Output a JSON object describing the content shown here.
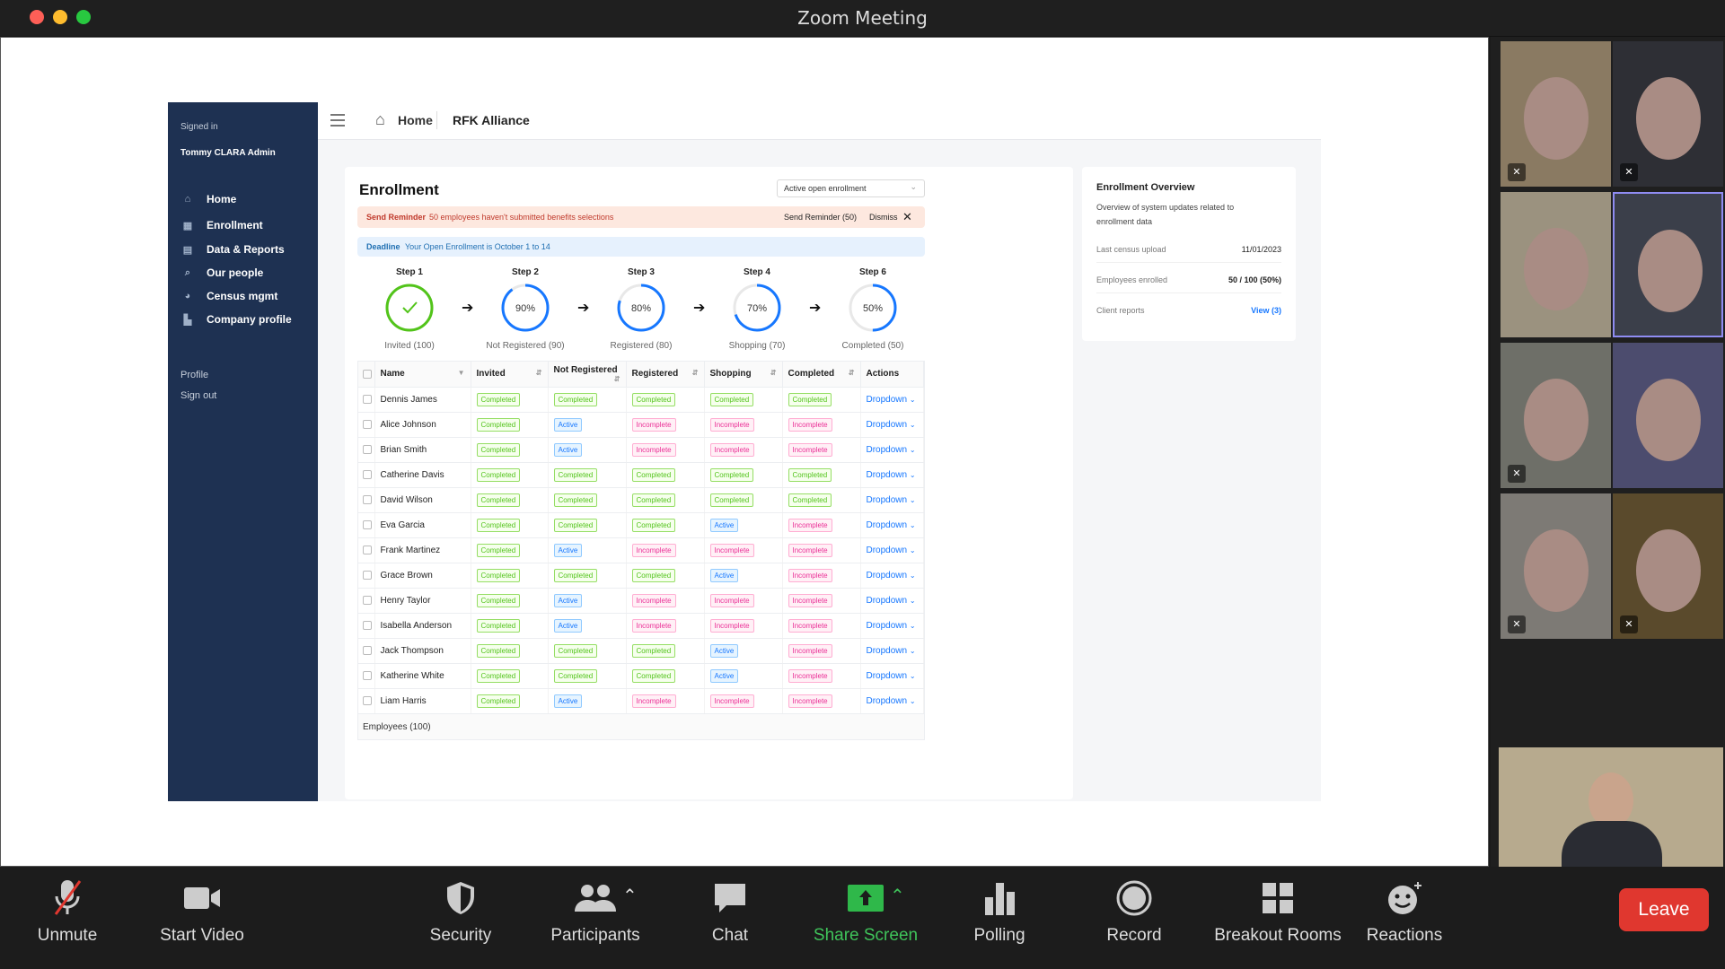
{
  "window": {
    "title": "Zoom Meeting"
  },
  "app": {
    "sidebar": {
      "signed_in": "Signed in",
      "user": "Tommy CLARA Admin",
      "nav": [
        "Home",
        "Enrollment",
        "Data & Reports",
        "Our people",
        "Census mgmt",
        "Company profile"
      ],
      "profile": "Profile",
      "sign_out": "Sign out"
    },
    "topnav": {
      "home": "Home",
      "org": "RFK Alliance"
    },
    "enrollment": {
      "title": "Enrollment",
      "select_value": "Active open enrollment",
      "reminder": {
        "label": "Send Reminder",
        "text": "50 employees haven't submitted benefits selections",
        "action": "Send Reminder (50)",
        "dismiss": "Dismiss"
      },
      "deadline": {
        "label": "Deadline",
        "text": "Your Open Enrollment is October 1 to 14"
      },
      "steps": [
        {
          "title": "Step 1",
          "value": "",
          "percent": 100,
          "check": true,
          "sub": "Invited (100)"
        },
        {
          "title": "Step 2",
          "value": "90%",
          "percent": 90,
          "sub": "Not Registered (90)"
        },
        {
          "title": "Step 3",
          "value": "80%",
          "percent": 80,
          "sub": "Registered (80)"
        },
        {
          "title": "Step 4",
          "value": "70%",
          "percent": 70,
          "sub": "Shopping (70)"
        },
        {
          "title": "Step 6",
          "value": "50%",
          "percent": 50,
          "sub": "Completed (50)"
        }
      ],
      "table": {
        "columns": [
          "Name",
          "Invited",
          "Not Registered",
          "Registered",
          "Shopping",
          "Completed",
          "Actions"
        ],
        "rows": [
          [
            "Dennis James",
            "Completed",
            "Completed",
            "Completed",
            "Completed",
            "Completed"
          ],
          [
            "Alice Johnson",
            "Completed",
            "Active",
            "Incomplete",
            "Incomplete",
            "Incomplete"
          ],
          [
            "Brian Smith",
            "Completed",
            "Active",
            "Incomplete",
            "Incomplete",
            "Incomplete"
          ],
          [
            "Catherine Davis",
            "Completed",
            "Completed",
            "Completed",
            "Completed",
            "Completed"
          ],
          [
            "David Wilson",
            "Completed",
            "Completed",
            "Completed",
            "Completed",
            "Completed"
          ],
          [
            "Eva Garcia",
            "Completed",
            "Completed",
            "Completed",
            "Active",
            "Incomplete"
          ],
          [
            "Frank Martinez",
            "Completed",
            "Active",
            "Incomplete",
            "Incomplete",
            "Incomplete"
          ],
          [
            "Grace Brown",
            "Completed",
            "Completed",
            "Completed",
            "Active",
            "Incomplete"
          ],
          [
            "Henry Taylor",
            "Completed",
            "Active",
            "Incomplete",
            "Incomplete",
            "Incomplete"
          ],
          [
            "Isabella Anderson",
            "Completed",
            "Active",
            "Incomplete",
            "Incomplete",
            "Incomplete"
          ],
          [
            "Jack Thompson",
            "Completed",
            "Completed",
            "Completed",
            "Active",
            "Incomplete"
          ],
          [
            "Katherine White",
            "Completed",
            "Completed",
            "Completed",
            "Active",
            "Incomplete"
          ],
          [
            "Liam Harris",
            "Completed",
            "Active",
            "Incomplete",
            "Incomplete",
            "Incomplete"
          ]
        ],
        "action_label": "Dropdown",
        "footer": "Employees (100)"
      }
    },
    "overview": {
      "title": "Enrollment Overview",
      "desc": "Overview of system updates related to enrollment data",
      "items": [
        {
          "label": "Last census upload",
          "value": "11/01/2023"
        },
        {
          "label": "Employees enrolled",
          "value": "50 / 100 (50%)"
        },
        {
          "label": "Client reports",
          "value": "View (3)"
        }
      ]
    }
  },
  "toolbar": {
    "unmute": "Unmute",
    "start_video": "Start Video",
    "security": "Security",
    "participants": "Participants",
    "chat": "Chat",
    "share_screen": "Share Screen",
    "polling": "Polling",
    "record": "Record",
    "breakout": "Breakout Rooms",
    "reactions": "Reactions",
    "leave": "Leave"
  },
  "colors": {
    "accent": "#1677ff",
    "sidebar": "#1e3152",
    "leave": "#e0372f",
    "share": "#2fb84a"
  }
}
